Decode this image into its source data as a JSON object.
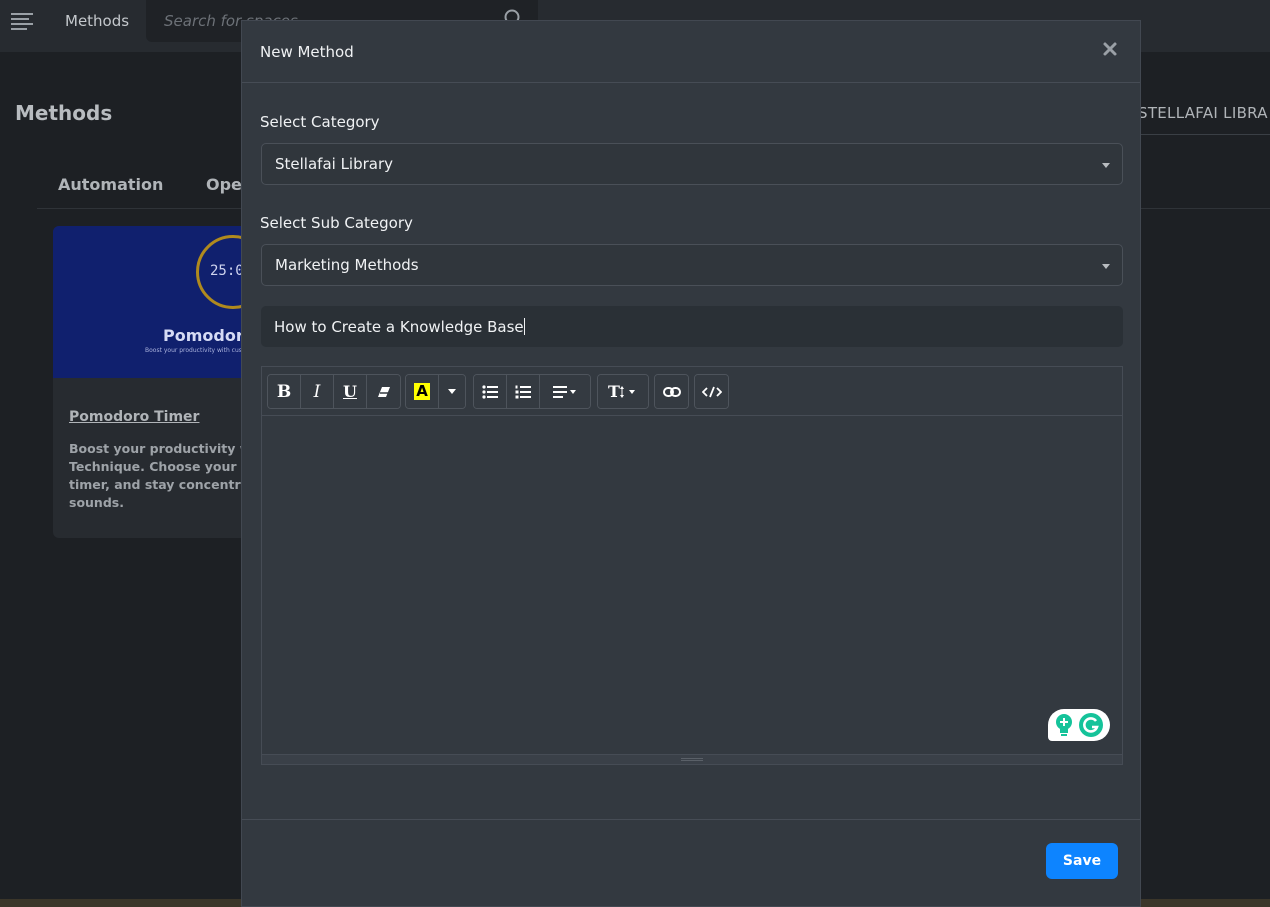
{
  "topbar": {
    "nav_title": "Methods",
    "search_placeholder": "Search for spaces"
  },
  "page": {
    "title": "Methods",
    "library_label": "STELLAFAI LIBRA",
    "tabs": [
      "Automation",
      "Ope"
    ]
  },
  "card": {
    "image_timer": "25:0",
    "image_title": "Pomodoro",
    "image_subtitle": "Boost your productivity with cus",
    "title": "Pomodoro Timer",
    "description": "Boost your productivity wi Technique. Choose your fo timer, and stay concentrat sounds."
  },
  "modal": {
    "title": "New Method",
    "category_label": "Select Category",
    "category_value": "Stellafai Library",
    "subcategory_label": "Select Sub Category",
    "subcategory_value": "Marketing Methods",
    "name_value": "How to Create a Knowledge Base",
    "save_label": "Save"
  },
  "toolbar": {
    "bold_label": "B",
    "italic_label": "I",
    "underline_label": "U",
    "highlight_label": "A",
    "font_size_label": "T"
  },
  "colors": {
    "accent": "#0d84ff",
    "modal_bg": "#333940",
    "highlight": "#ffff00",
    "grammarly": "#15c39a"
  }
}
